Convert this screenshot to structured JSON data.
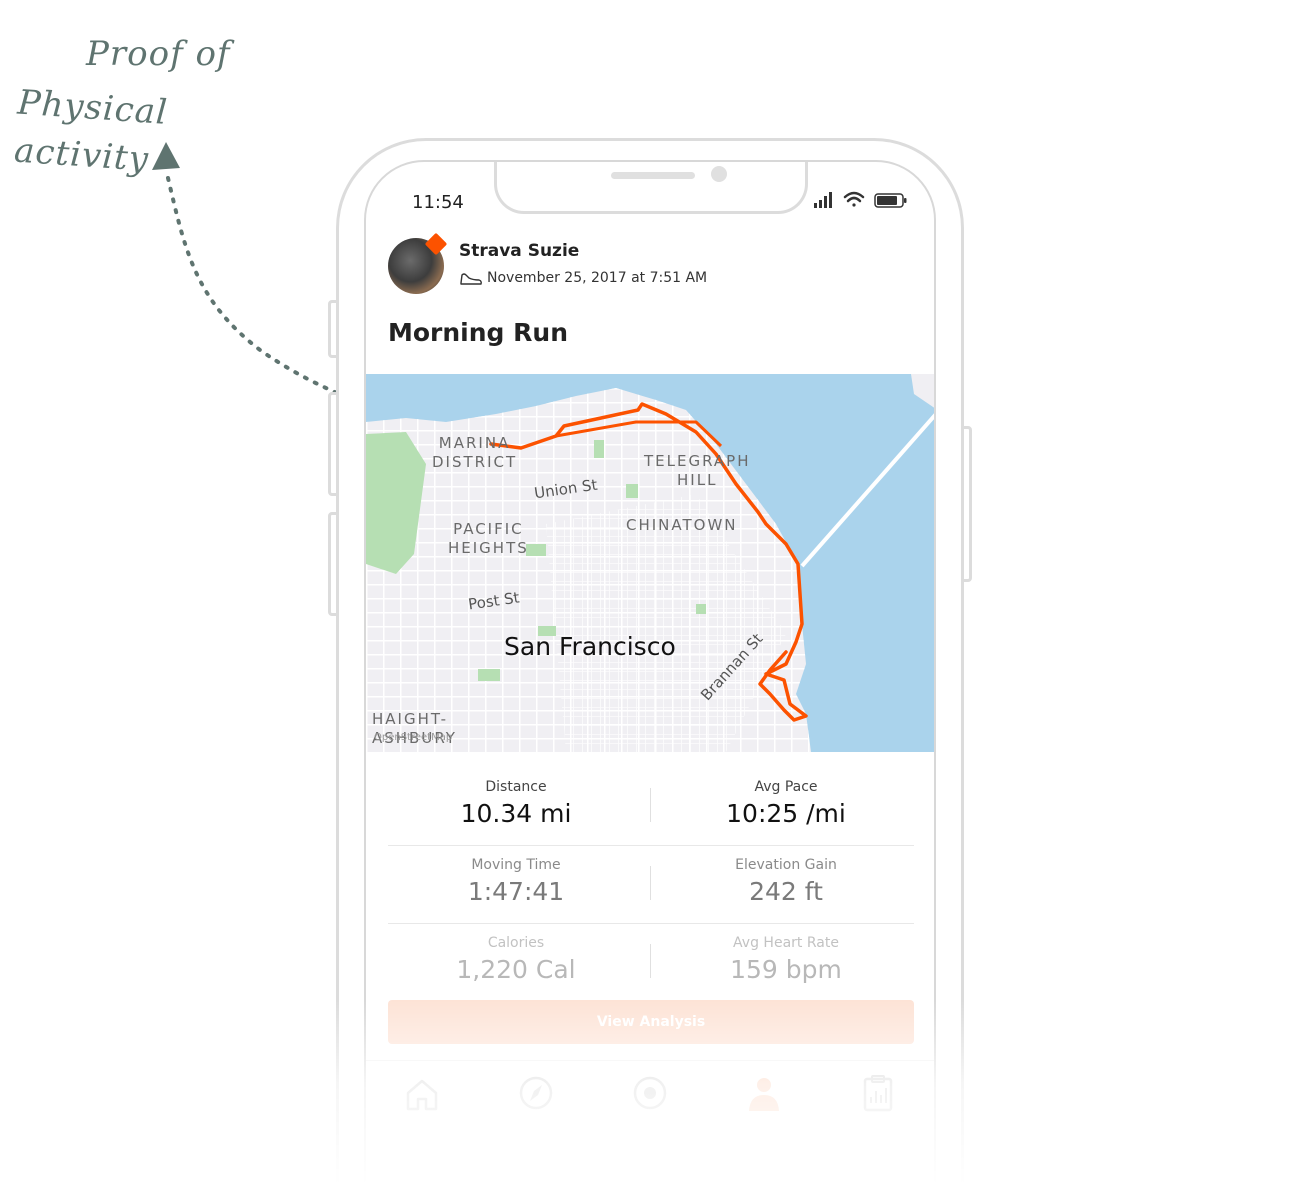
{
  "annotation": {
    "line1": "Proof of",
    "line2": "Physical activity"
  },
  "status_bar": {
    "time": "11:54",
    "icons": [
      "signal-icon",
      "wifi-icon",
      "battery-icon"
    ]
  },
  "activity": {
    "athlete_name": "Strava Suzie",
    "date": "November 25, 2017 at 7:51 AM",
    "title": "Morning Run",
    "type_icon": "shoe-icon"
  },
  "map": {
    "neighborhoods": {
      "marina": "MARINA\nDISTRICT",
      "telegraph": "TELEGRAPH\nHILL",
      "pacific": "PACIFIC\nHEIGHTS",
      "chinatown": "CHINATOWN",
      "haight": "HAIGHT-\nASHBURY"
    },
    "streets": {
      "union": "Union St",
      "post": "Post St",
      "brannan": "Brannan St"
    },
    "city": "San Francisco",
    "attribution": "OpenStreetMap",
    "colors": {
      "water": "#aad3ec",
      "land": "#f0eff3",
      "park": "#b6dfb3",
      "route": "#fc5200"
    }
  },
  "stats": [
    {
      "label": "Distance",
      "value": "10.34 mi"
    },
    {
      "label": "Avg Pace",
      "value": "10:25 /mi"
    },
    {
      "label": "Moving Time",
      "value": "1:47:41"
    },
    {
      "label": "Elevation Gain",
      "value": "242 ft"
    },
    {
      "label": "Calories",
      "value": "1,220 Cal"
    },
    {
      "label": "Avg Heart Rate",
      "value": "159 bpm"
    }
  ],
  "button": {
    "label": "View Analysis",
    "color": "#fde3d6"
  },
  "tabbar": [
    "home-icon",
    "explore-icon",
    "record-icon",
    "profile-icon",
    "training-log-icon"
  ],
  "brand_color": "#fc5200"
}
